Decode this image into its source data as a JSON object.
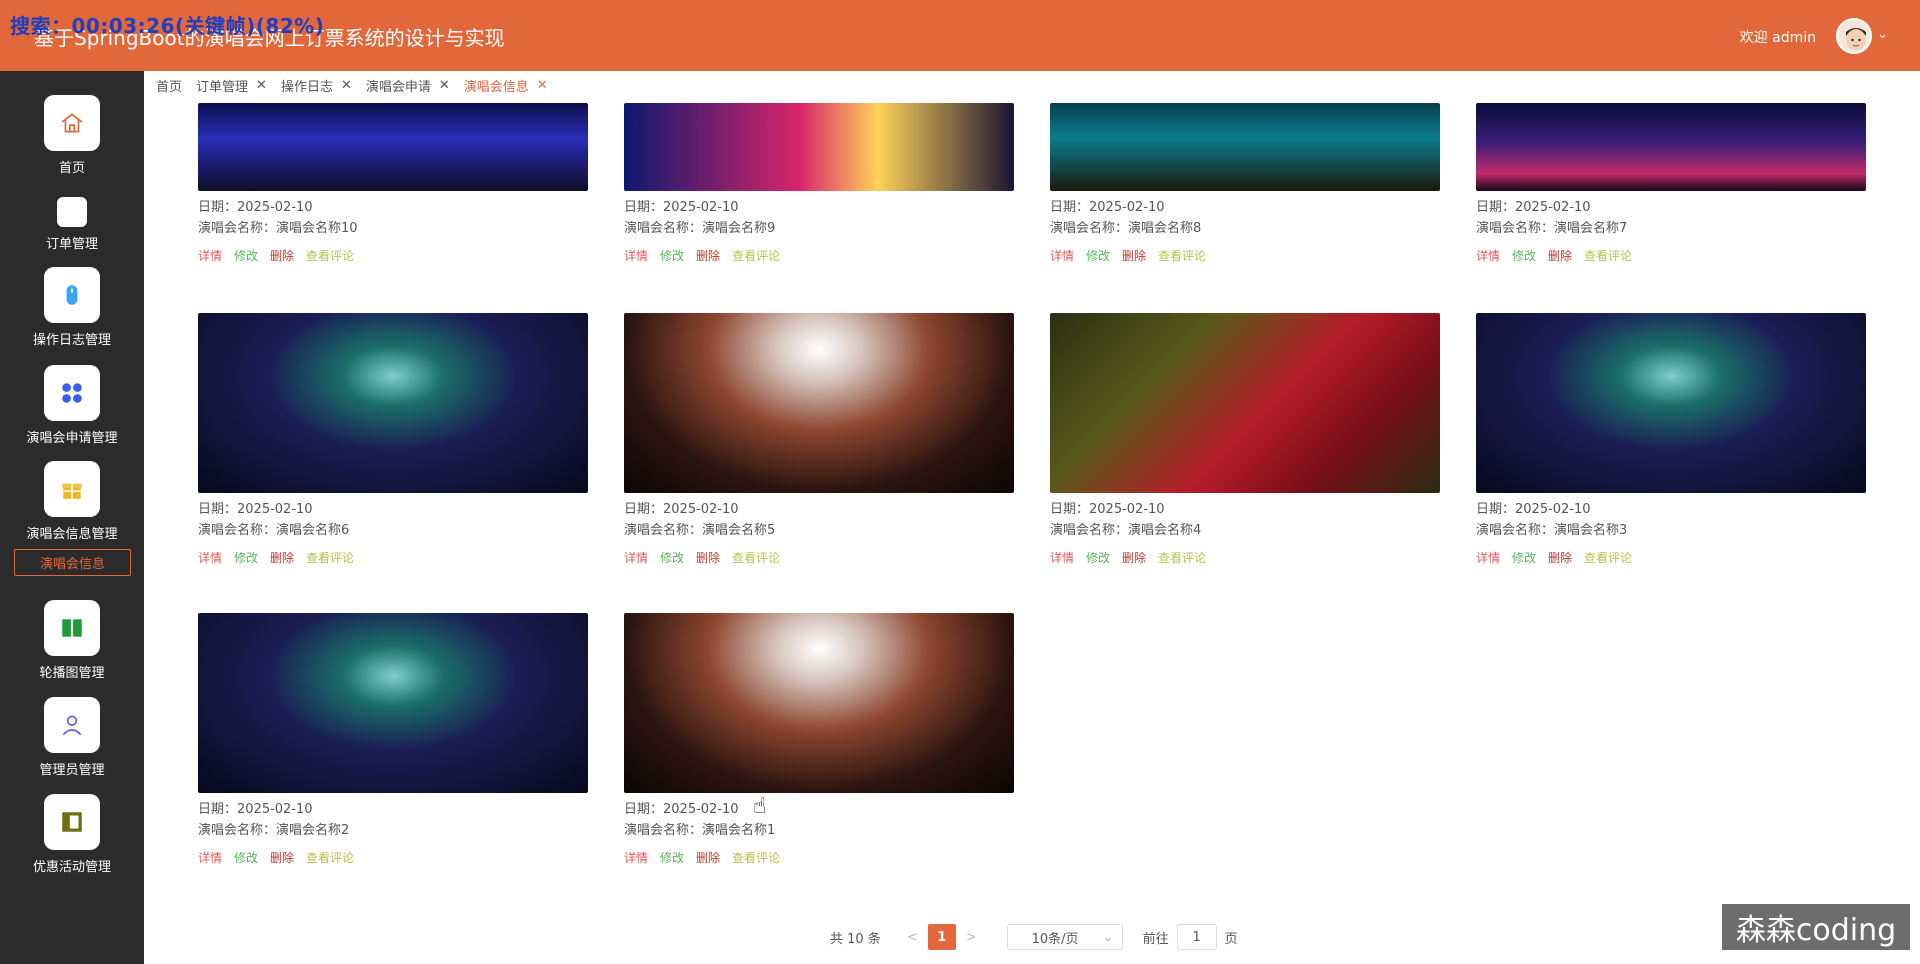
{
  "header": {
    "overlay": "搜索：00:03:26(关键帧)(82%)",
    "title": "基于SpringBoot的演唱会网上订票系统的设计与实现",
    "welcome": "欢迎 admin"
  },
  "sidebar": {
    "items": [
      {
        "label": "首页",
        "icon": "home-icon"
      },
      {
        "label": "订单管理",
        "icon": "blank-icon"
      },
      {
        "label": "操作日志管理",
        "icon": "mouse-icon"
      },
      {
        "label": "演唱会申请管理",
        "icon": "grid-icon"
      },
      {
        "label": "演唱会信息管理",
        "icon": "gift-icon"
      },
      {
        "label": "轮播图管理",
        "icon": "book-icon"
      },
      {
        "label": "管理员管理",
        "icon": "user-icon"
      },
      {
        "label": "优惠活动管理",
        "icon": "panel-icon"
      }
    ],
    "sub_item": "演唱会信息"
  },
  "tabs": [
    {
      "label": "首页",
      "closable": false
    },
    {
      "label": "订单管理",
      "closable": true
    },
    {
      "label": "操作日志",
      "closable": true
    },
    {
      "label": "演唱会申请",
      "closable": true
    },
    {
      "label": "演唱会信息",
      "closable": true
    }
  ],
  "cards": [
    {
      "date": "日期：2025-02-10",
      "name": "演唱会名称：演唱会名称10",
      "style": "blue"
    },
    {
      "date": "日期：2025-02-10",
      "name": "演唱会名称：演唱会名称9",
      "style": "lazer"
    },
    {
      "date": "日期：2025-02-10",
      "name": "演唱会名称：演唱会名称8",
      "style": "teal"
    },
    {
      "date": "日期：2025-02-10",
      "name": "演唱会名称：演唱会名称7",
      "style": "violet"
    },
    {
      "date": "日期：2025-02-10",
      "name": "演唱会名称：演唱会名称6",
      "style": "stage"
    },
    {
      "date": "日期：2025-02-10",
      "name": "演唱会名称：演唱会名称5",
      "style": "burst"
    },
    {
      "date": "日期：2025-02-10",
      "name": "演唱会名称：演唱会名称4",
      "style": "red"
    },
    {
      "date": "日期：2025-02-10",
      "name": "演唱会名称：演唱会名称3",
      "style": "stage"
    },
    {
      "date": "日期：2025-02-10",
      "name": "演唱会名称：演唱会名称2",
      "style": "stage"
    },
    {
      "date": "日期：2025-02-10",
      "name": "演唱会名称：演唱会名称1",
      "style": "burst"
    }
  ],
  "actions": {
    "detail": "详情",
    "edit": "修改",
    "delete": "删除",
    "comment": "查看评论"
  },
  "pagination": {
    "total": "共 10 条",
    "prev": "<",
    "current": "1",
    "next": ">",
    "page_size": "10条/页",
    "goto_label": "前往",
    "goto_value": "1",
    "page_suffix": "页"
  },
  "watermark": "森森coding",
  "colors": {
    "accent": "#e2673b",
    "sidebar": "#2b2b2b"
  }
}
